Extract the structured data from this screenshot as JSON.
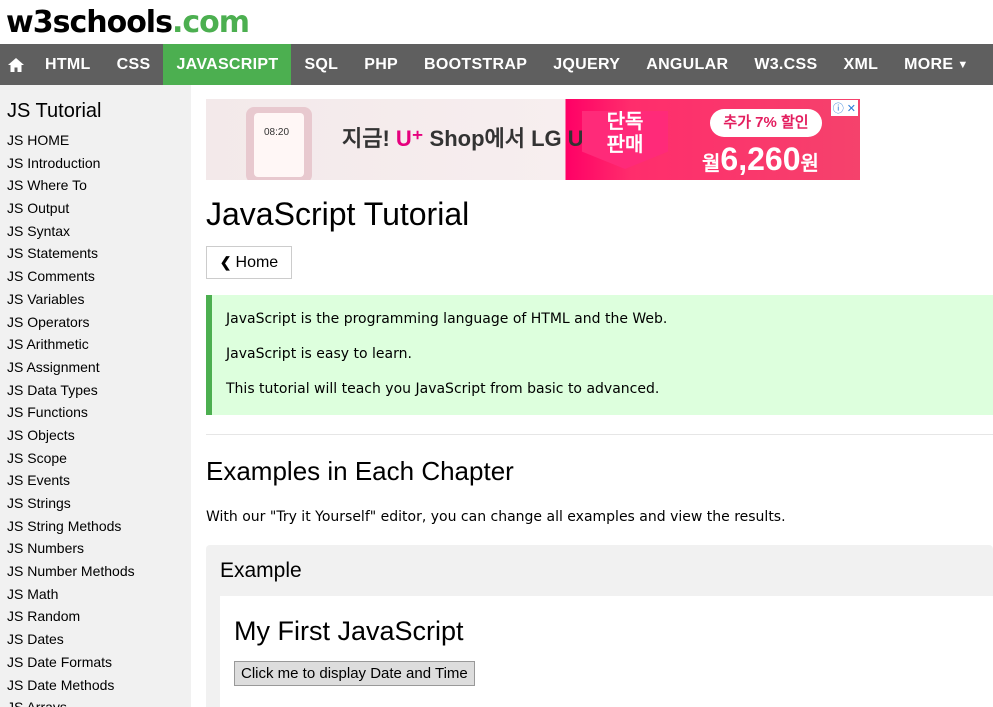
{
  "logo": {
    "w3": "w3schools",
    "com": ".com"
  },
  "topnav": {
    "home_icon": "home-icon",
    "items": [
      {
        "label": "HTML"
      },
      {
        "label": "CSS"
      },
      {
        "label": "JAVASCRIPT"
      },
      {
        "label": "SQL"
      },
      {
        "label": "PHP"
      },
      {
        "label": "BOOTSTRAP"
      },
      {
        "label": "JQUERY"
      },
      {
        "label": "ANGULAR"
      },
      {
        "label": "W3.CSS"
      },
      {
        "label": "XML"
      },
      {
        "label": "MORE"
      }
    ],
    "active_color": "#4CAF50",
    "bar_color": "#5f5f5f"
  },
  "sidebar": {
    "title": "JS Tutorial",
    "items": [
      {
        "label": "JS HOME"
      },
      {
        "label": "JS Introduction"
      },
      {
        "label": "JS Where To"
      },
      {
        "label": "JS Output"
      },
      {
        "label": "JS Syntax"
      },
      {
        "label": "JS Statements"
      },
      {
        "label": "JS Comments"
      },
      {
        "label": "JS Variables"
      },
      {
        "label": "JS Operators"
      },
      {
        "label": "JS Arithmetic"
      },
      {
        "label": "JS Assignment"
      },
      {
        "label": "JS Data Types"
      },
      {
        "label": "JS Functions"
      },
      {
        "label": "JS Objects"
      },
      {
        "label": "JS Scope"
      },
      {
        "label": "JS Events"
      },
      {
        "label": "JS Strings"
      },
      {
        "label": "JS String Methods"
      },
      {
        "label": "JS Numbers"
      },
      {
        "label": "JS Number Methods"
      },
      {
        "label": "JS Math"
      },
      {
        "label": "JS Random"
      },
      {
        "label": "JS Dates"
      },
      {
        "label": "JS Date Formats"
      },
      {
        "label": "JS Date Methods"
      },
      {
        "label": "JS Arrays"
      }
    ]
  },
  "ad": {
    "phone_time": "08:20",
    "text_pre": "지금! ",
    "text_u": "U⁺",
    "text_post": " Shop에서 LG U",
    "hot": "단독\n판매",
    "tag": "추가 7% 할인",
    "price_pre": "월",
    "price": "6,260",
    "price_post": "원",
    "close": "ⓘ ✕"
  },
  "main": {
    "title": "JavaScript Tutorial",
    "home_button": "Home",
    "notice": [
      "JavaScript is the programming language of HTML and the Web.",
      "JavaScript is easy to learn.",
      "This tutorial will teach you JavaScript from basic to advanced."
    ],
    "section_title": "Examples in Each Chapter",
    "section_desc": "With our \"Try it Yourself\" editor, you can change all examples and view the results.",
    "example": {
      "label": "Example",
      "heading": "My First JavaScript",
      "button": "Click me to display Date and Time"
    }
  }
}
